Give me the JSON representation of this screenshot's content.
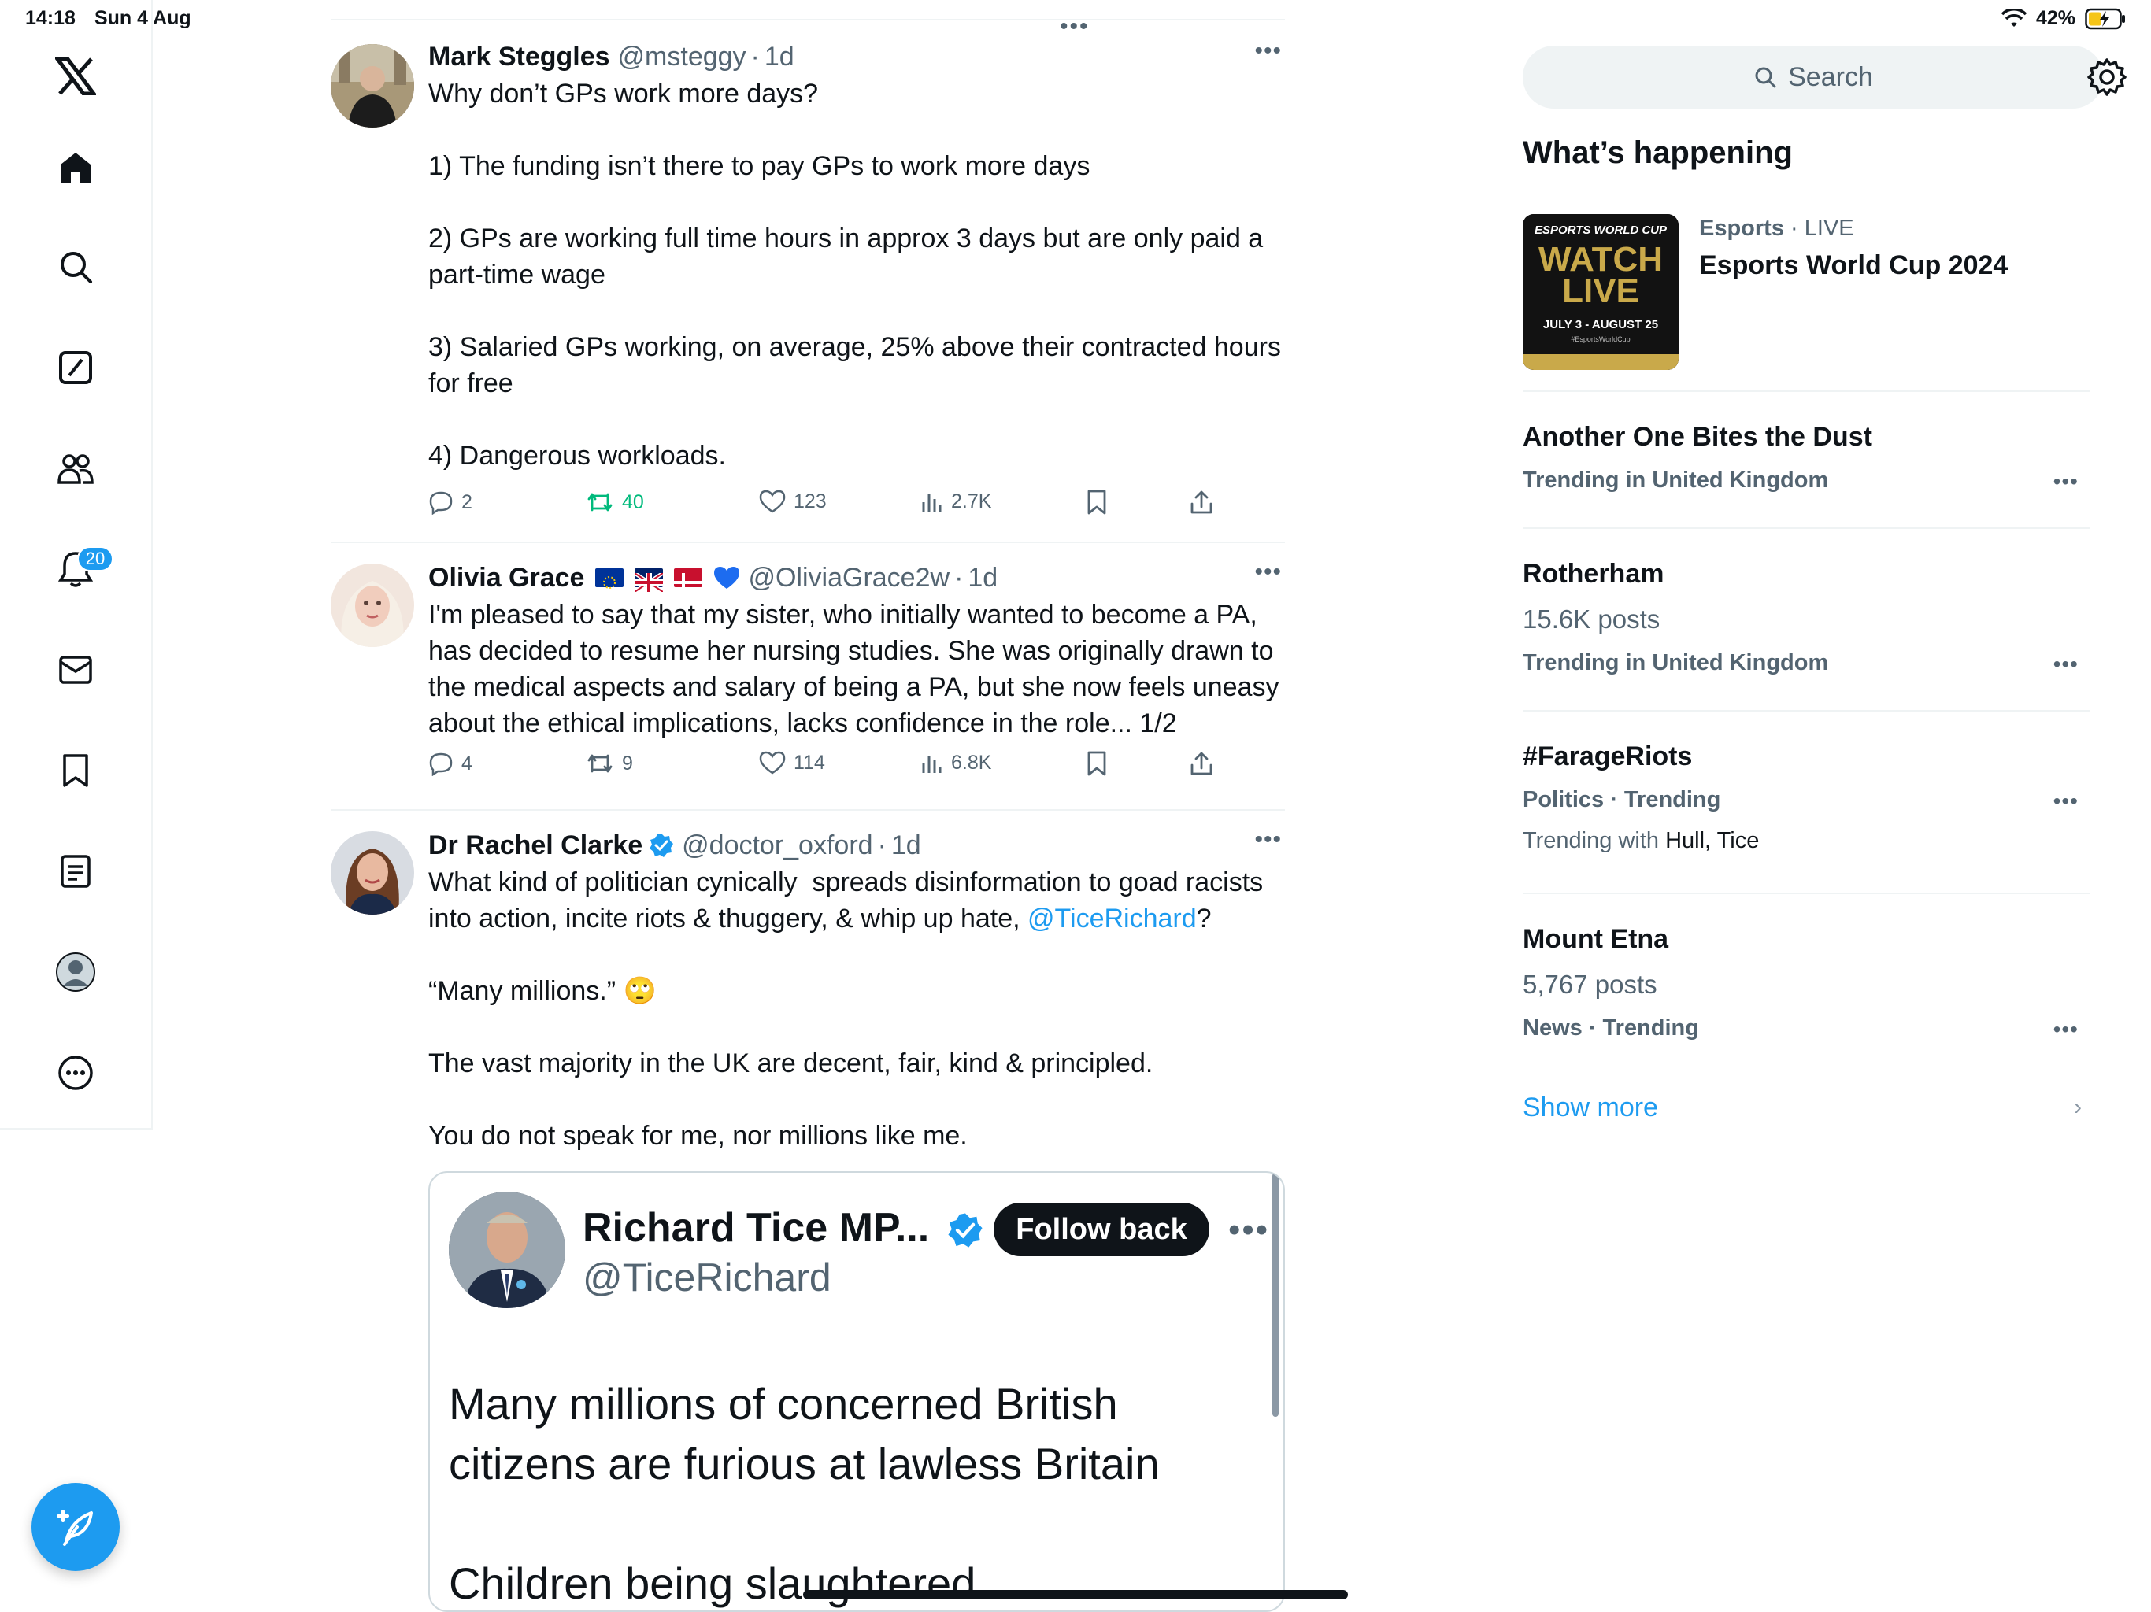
{
  "status_bar": {
    "time": "14:18",
    "date": "Sun 4 Aug",
    "battery": "42%"
  },
  "nav": {
    "notification_count": "20"
  },
  "tweets": [
    {
      "name": "Mark Steggles",
      "handle": "@msteggy",
      "time": "1d",
      "text": "Why don’t GPs work more days?\n\n1) The funding isn’t there to pay GPs to work more days\n\n2) GPs are working full time hours in approx 3 days but are only paid a part-time wage\n\n3) Salaried GPs working, on average, 25% above their contracted hours for free\n\n4) Dangerous workloads.",
      "replies": "2",
      "retweets": "40",
      "likes": "123",
      "views": "2.7K"
    },
    {
      "name": "Olivia Grace",
      "handle": "@OliviaGrace2w",
      "time": "1d",
      "text": "I'm pleased to say that my sister, who initially wanted to become a PA, has decided to resume her nursing studies. She was originally drawn to the medical aspects and salary of being a PA, but she now feels uneasy about the ethical implications, lacks confidence in the role... 1/2",
      "replies": "4",
      "retweets": "9",
      "likes": "114",
      "views": "6.8K"
    },
    {
      "name": "Dr Rachel Clarke",
      "handle": "@doctor_oxford",
      "time": "1d",
      "text_before_mention": "What kind of politician cynically  spreads disinformation to goad racists into action, incite riots & thuggery, & whip up hate, ",
      "mention": "@TiceRichard",
      "text_after_mention": "?\n\n“Many millions.” 🙄\n\nThe vast majority in the UK are decent, fair, kind & principled.\n\nYou do not speak for me, nor millions like me.",
      "embed": {
        "name": "Richard Tice MP...",
        "handle": "@TiceRichard",
        "follow_label": "Follow back",
        "text": "Many millions of concerned British citizens are furious at lawless Britain\n\nChildren being slaughtered"
      }
    }
  ],
  "sidebar": {
    "search_placeholder": "Search",
    "title": "What’s happening",
    "trends": [
      {
        "category": "Esports",
        "status": "LIVE",
        "title": "Esports World Cup 2024",
        "image_title_small": "ESPORTS WORLD CUP",
        "image_title": "WATCH LIVE",
        "image_dates": "JULY 3 - AUGUST 25",
        "image_tag": "#EsportsWorldCup"
      },
      {
        "title": "Another One Bites the Dust",
        "meta": "Trending in United Kingdom"
      },
      {
        "title": "Rotherham",
        "posts": "15.6K posts",
        "meta": "Trending in United Kingdom"
      },
      {
        "title": "#FarageRiots",
        "meta": "Politics · Trending",
        "with_label": "Trending with",
        "with_value": "Hull, Tice"
      },
      {
        "title": "Mount Etna",
        "posts": "5,767 posts",
        "meta": "News · Trending"
      }
    ],
    "show_more": "Show more"
  },
  "colors": {
    "accent": "#1d9bf0",
    "retweet_green": "#00ba7c",
    "text_primary": "#0f1419",
    "text_secondary": "#536471"
  }
}
